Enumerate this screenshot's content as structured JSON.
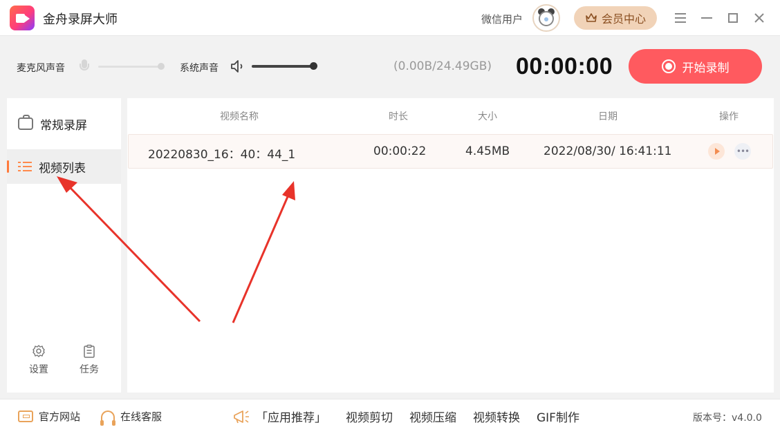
{
  "app": {
    "title": "金舟录屏大师",
    "user_name": "微信用户",
    "vip_label": "会员中心"
  },
  "toolbar": {
    "mic_label": "麦克风声音",
    "system_label": "系统声音",
    "storage": "(0.00B/24.49GB)",
    "timer": "00:00:00",
    "record_label": "开始录制",
    "mic_level": 1.0,
    "system_level": 1.0
  },
  "sidebar": {
    "items": [
      {
        "label": "常规录屏",
        "icon": "camera-icon",
        "active": false
      },
      {
        "label": "视频列表",
        "icon": "list-icon",
        "active": true
      }
    ],
    "settings_label": "设置",
    "tasks_label": "任务"
  },
  "table": {
    "columns": [
      "视频名称",
      "时长",
      "大小",
      "日期",
      "操作"
    ],
    "rows": [
      {
        "name": "20220830_16：40：44_1",
        "duration": "00:00:22",
        "size": "4.45MB",
        "date": "2022/08/30/ 16:41:11"
      }
    ]
  },
  "footer": {
    "site_label": "官方网站",
    "service_label": "在线客服",
    "recommend_label": "「应用推荐」",
    "links": [
      "视频剪切",
      "视频压缩",
      "视频转换",
      "GIF制作"
    ],
    "version": "版本号：v4.0.0"
  },
  "colors": {
    "record": "#ff5a5f",
    "accent": "#ff7a3c",
    "vip_bg": "#f1d3b8",
    "arrow": "#e8332a"
  }
}
